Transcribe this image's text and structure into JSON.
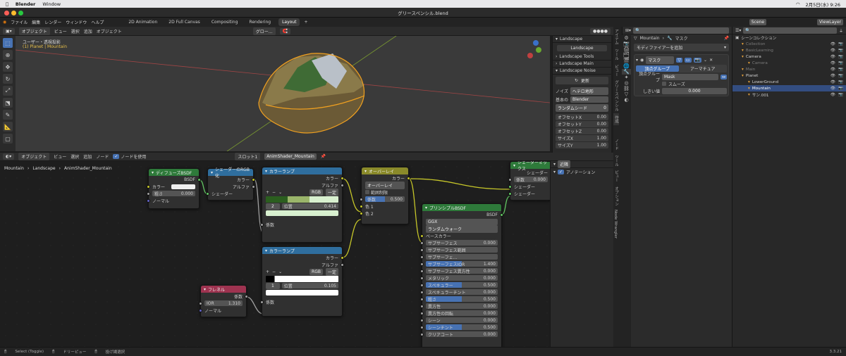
{
  "macbar": {
    "app": "Blender",
    "menu": "Window",
    "clock": "2月5日(水) 9:26"
  },
  "window": {
    "title": "グリースペンシル.blend"
  },
  "topbar": {
    "menus": [
      "ファイル",
      "編集",
      "レンダー",
      "ウィンドウ",
      "ヘルプ"
    ],
    "workspaces": [
      "2D Animation",
      "2D Full Canvas",
      "Compositing",
      "Rendering",
      "Layout"
    ],
    "active_workspace": "Layout",
    "scene": "Scene",
    "viewlayer": "ViewLayer"
  },
  "viewport": {
    "mode": "オブジェクト",
    "menus": [
      "ビュー",
      "選択",
      "追加",
      "オブジェクト"
    ],
    "orientation": "グロー…",
    "info1": "ユーザー・透視投影",
    "info2": "(1) Planet | Mountain"
  },
  "npanel": {
    "tabs": [
      "アイテム",
      "ツール",
      "ビュー",
      "グリースペンシル",
      "作成"
    ],
    "landscape": "Landscape",
    "landscape_btn": "Landscape",
    "tools": "Landscape Tools",
    "main": "Landscape Main",
    "noise": "Landscape Noise",
    "update": "更新",
    "noise_label": "ノイズ",
    "noise_val": "ヘテロ地形",
    "basis_label": "基本の",
    "basis_val": "Blender",
    "seed_label": "ランダムシード",
    "seed_val": "0",
    "rows": [
      {
        "k": "オフセットX",
        "v": "0.00"
      },
      {
        "k": "オフセットY",
        "v": "0.00"
      },
      {
        "k": "オフセットZ",
        "v": "0.00"
      },
      {
        "k": "サイズX",
        "v": "1.00"
      },
      {
        "k": "サイズY",
        "v": "1.00"
      }
    ]
  },
  "nodeeditor": {
    "mode": "オブジェクト",
    "menus": [
      "ビュー",
      "選択",
      "追加",
      "ノード"
    ],
    "use_nodes": "ノードを使用",
    "slot": "スロット1",
    "material": "AnimShader_Mountain",
    "breadcrumb": [
      "Mountain",
      "Landscape",
      "AnimShader_Mountain"
    ]
  },
  "nodes": {
    "diffuse": {
      "title": "ディフューズBSDF",
      "out": "BSDF",
      "color": "カラー",
      "rough": "粗さ",
      "rough_val": "0.000",
      "normal": "ノーマル"
    },
    "torgb": {
      "title": "シェーダーのRGB化",
      "color": "カラー",
      "alpha": "アルファ",
      "shader": "シェーダー"
    },
    "ramp1": {
      "title": "カラーランプ",
      "color": "カラー",
      "alpha": "アルファ",
      "mode": "RGB",
      "interp": "一定",
      "idx": "2",
      "pos": "位置",
      "pos_val": "0.414",
      "fac": "係数"
    },
    "ramp2": {
      "title": "カラーランプ",
      "color": "カラー",
      "alpha": "アルファ",
      "mode": "RGB",
      "interp": "一定",
      "idx": "1",
      "pos": "位置",
      "pos_val": "0.105",
      "fac": "係数"
    },
    "overlay": {
      "title": "オーバーレイ",
      "color": "カラー",
      "mode": "オーバーレイ",
      "clamp": "範囲制限",
      "fac": "係数",
      "fac_val": "0.500",
      "c1": "色 1",
      "c2": "色 2"
    },
    "fresnel": {
      "title": "フレネル",
      "out": "係数",
      "ior": "IOR",
      "ior_val": "1.310",
      "normal": "ノーマル"
    },
    "mix": {
      "title": "シェーダーミックス",
      "out": "シェーダー",
      "fac": "係数",
      "fac_val": "0.000",
      "s1": "シェーダー",
      "s2": "シェーダー"
    },
    "principled": {
      "title": "プリンシプルBSDF",
      "out": "BSDF",
      "dist": "GGX",
      "sss": "ランダムウォーク",
      "base": "ベースカラー",
      "rows": [
        {
          "k": "サブサーフェス",
          "v": "0.000"
        },
        {
          "k": "サブサーフェス範囲",
          "v": ""
        },
        {
          "k": "サブサーフェ…",
          "v": ""
        },
        {
          "k": "サブサーフェスIOR",
          "v": "1.400",
          "hl": true
        },
        {
          "k": "サブサーフェス異方性",
          "v": "0.000"
        },
        {
          "k": "メタリック",
          "v": "0.000"
        },
        {
          "k": "スペキュラー",
          "v": "0.500",
          "hl": true
        },
        {
          "k": "スペキュラーチント",
          "v": "0.000"
        },
        {
          "k": "粗さ",
          "v": "0.500",
          "hl": true
        },
        {
          "k": "異方性",
          "v": "0.000"
        },
        {
          "k": "異方性の回転",
          "v": "0.000"
        },
        {
          "k": "シーン",
          "v": "0.000"
        },
        {
          "k": "シーンチント",
          "v": "0.500",
          "hl": true
        },
        {
          "k": "クリアコート",
          "v": "0.000"
        }
      ]
    }
  },
  "rside": {
    "item": "近隣",
    "annotation": "アノテーション",
    "tabs": [
      "ノード",
      "ツール",
      "ビュー",
      "オプション",
      "Node Wrangler"
    ]
  },
  "props": {
    "object": "Mountain",
    "modifier_tab": "マスク",
    "add_modifier": "モディファイアーを追加",
    "mod_name": "マスク",
    "tab1": "頂点グループ",
    "tab2": "アーマチュア",
    "vgroup_label": "頂点グループ",
    "vgroup_val": "Mask",
    "smooth": "スムーズ",
    "threshold": "しきい値",
    "threshold_val": "0.000"
  },
  "outliner": {
    "title": "シーンコレクション",
    "items": [
      {
        "name": "Collection",
        "indent": 1,
        "dim": true
      },
      {
        "name": "BasicLearning",
        "indent": 1,
        "dim": true
      },
      {
        "name": "Camera",
        "indent": 1
      },
      {
        "name": "Camera",
        "indent": 2,
        "dim": true
      },
      {
        "name": "Main",
        "indent": 1,
        "dim": true
      },
      {
        "name": "Planet",
        "indent": 1
      },
      {
        "name": "LowerGround",
        "indent": 2
      },
      {
        "name": "Mountain",
        "indent": 2,
        "sel": true
      },
      {
        "name": "サン.001",
        "indent": 2
      }
    ]
  },
  "status": {
    "s1": "Select (Toggle)",
    "s2": "ドリーピュー",
    "s3": "投げ縄選択",
    "version": "3.3.21"
  },
  "colors": {
    "accent": "#4772b3",
    "shader_socket": "#63c763",
    "color_socket": "#c7c729"
  }
}
